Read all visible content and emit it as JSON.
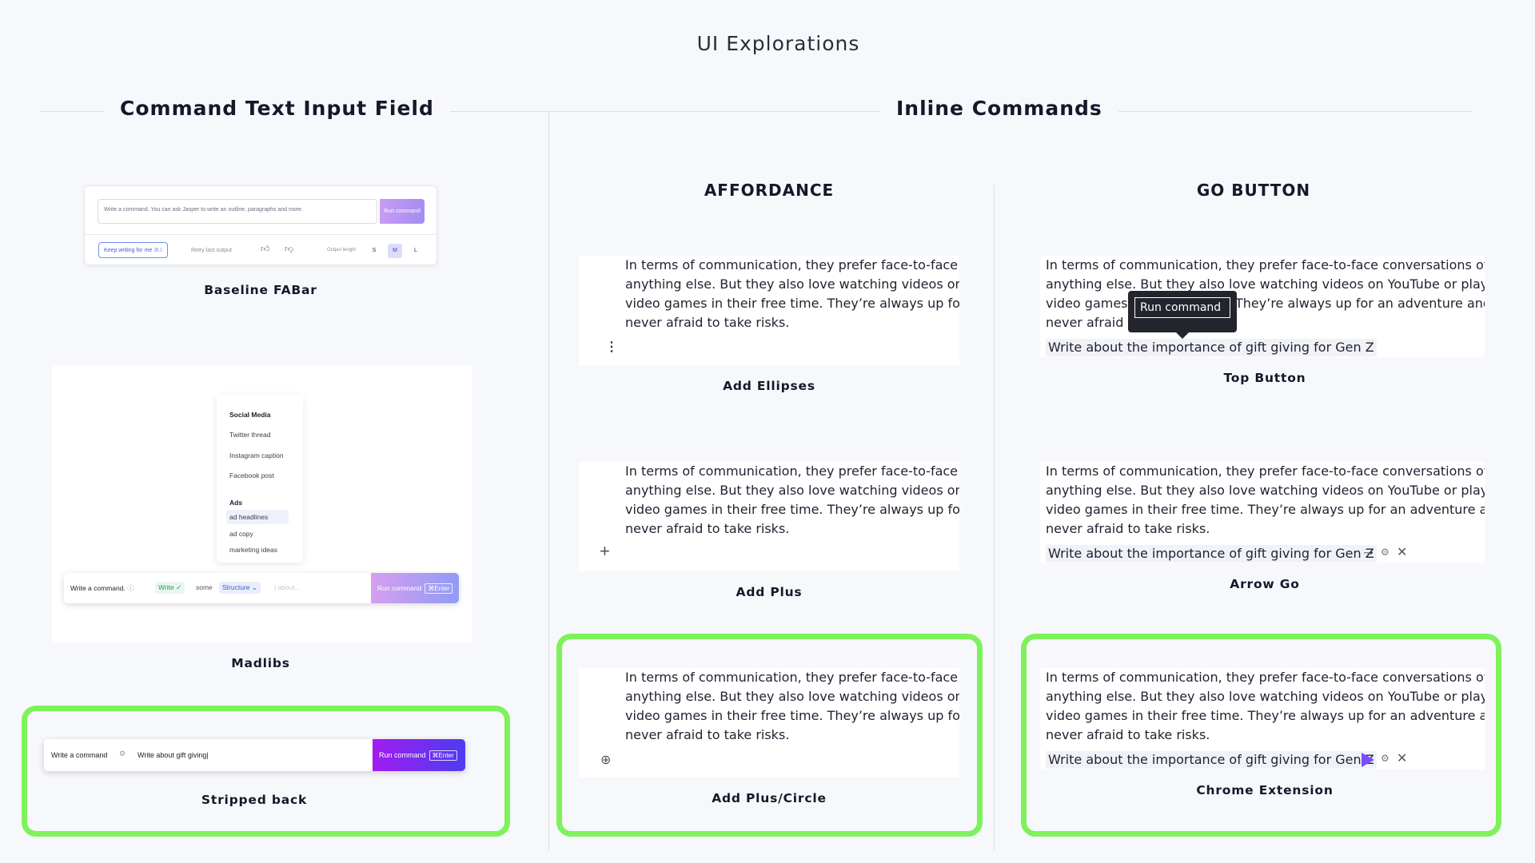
{
  "page": {
    "title": "UI Explorations"
  },
  "sections": {
    "left_title": "Command Text Input Field",
    "right_title": "Inline Commands"
  },
  "columns": {
    "affordance": "AFFORDANCE",
    "go_button": "GO BUTTON"
  },
  "baseline": {
    "placeholder": "Write a command. You can ask Jasper to write an outline, paragraphs and more.",
    "run_label": "Run command",
    "keep_writing": "Keep writing for me",
    "keep_shortcut": "⌘J",
    "retry": "Retry last output",
    "output_length": "Output length",
    "sizes": [
      "S",
      "M",
      "L"
    ],
    "caption": "Baseline FABar"
  },
  "madlibs": {
    "menu": {
      "group1": "Social Media",
      "group1_items": [
        "Twitter thread",
        "Instagram caption",
        "Facebook post"
      ],
      "group2": "Ads",
      "group2_items": [
        "ad headlines",
        "ad copy",
        "marketing ideas"
      ]
    },
    "bar": {
      "label": "Write a command.",
      "write": "Write",
      "some": "some",
      "structure": "Structure",
      "about": "about...",
      "run_label": "Run command",
      "kbd": "⌘Enter"
    },
    "caption": "Madlibs"
  },
  "stripped": {
    "label": "Write a command",
    "value": "Write about gift giving",
    "run_label": "Run command",
    "kbd": "⌘Enter",
    "caption": "Stripped back"
  },
  "paragraph": {
    "line1": "In terms of communication, they prefer face-to-face conversations over",
    "line2": "anything else. But they also love watching videos on YouTube or playing",
    "line3": "video games in their free time. They’re always up for an adventure and",
    "line4": "never afraid to take risks.",
    "line3_left": "video games",
    "line3_right": "They’re always up for an adventure and",
    "line4_left": "never afraid t"
  },
  "command_text": "Write about the importance of gift giving for Gen Z",
  "tooltip_label": "Run command",
  "captions": {
    "ellipses": "Add Ellipses",
    "plus": "Add Plus",
    "plus_circle": "Add Plus/Circle",
    "top_button": "Top Button",
    "arrow_go": "Arrow Go",
    "chrome": "Chrome Extension"
  },
  "colors": {
    "highlight": "#7ef25c",
    "accent_purple": "#7b4dff",
    "run_gradient_start": "#a21cf0",
    "run_gradient_end": "#4d3cf0"
  }
}
